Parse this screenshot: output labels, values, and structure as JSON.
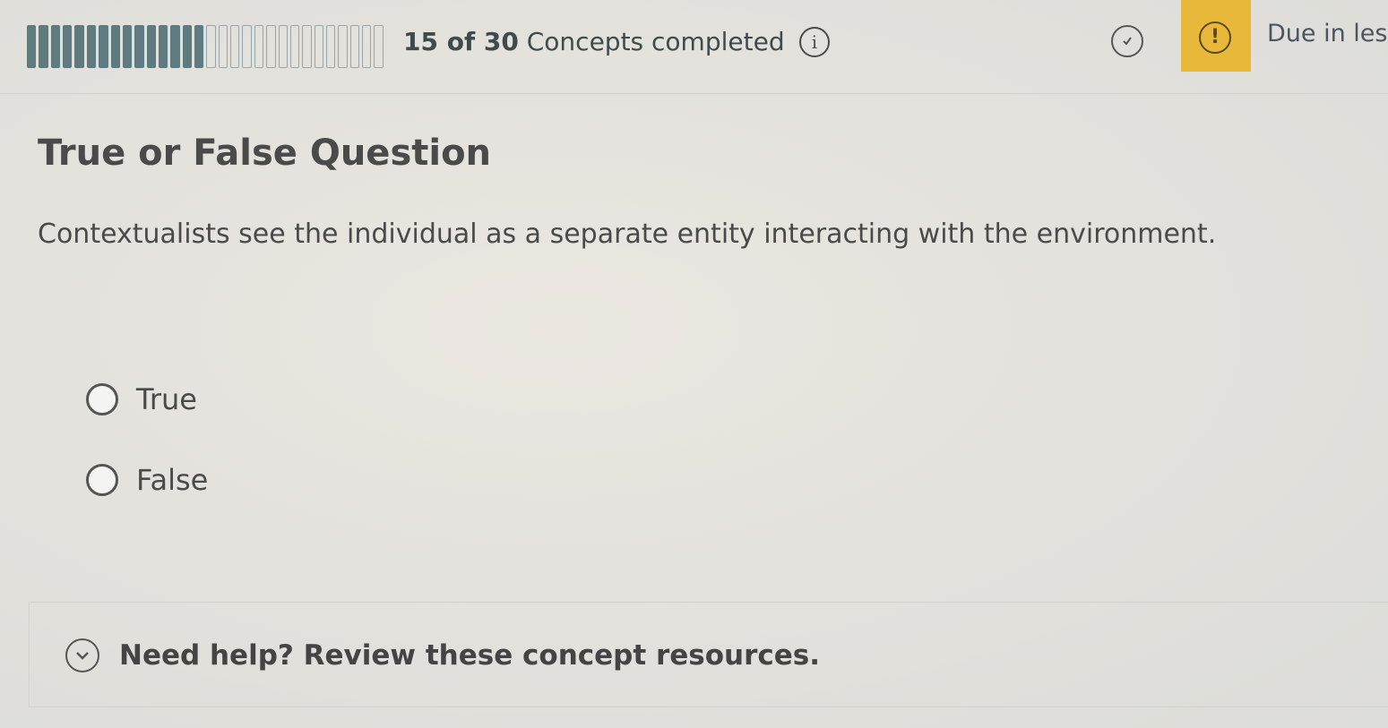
{
  "header": {
    "progress": {
      "completed": 15,
      "total": 30,
      "count_text": "15 of 30",
      "suffix_text": " Concepts completed"
    },
    "info_icon": "i",
    "due_text": "Due in les",
    "alert_icon": "!"
  },
  "question": {
    "title": "True or False Question",
    "text": "Contextualists see the individual as a separate entity interacting with the environment.",
    "options": [
      {
        "label": "True"
      },
      {
        "label": "False"
      }
    ]
  },
  "help": {
    "text": "Need help? Review these concept resources."
  },
  "colors": {
    "progress_fill": "#5e7c80",
    "due_accent": "#e8b83a"
  }
}
